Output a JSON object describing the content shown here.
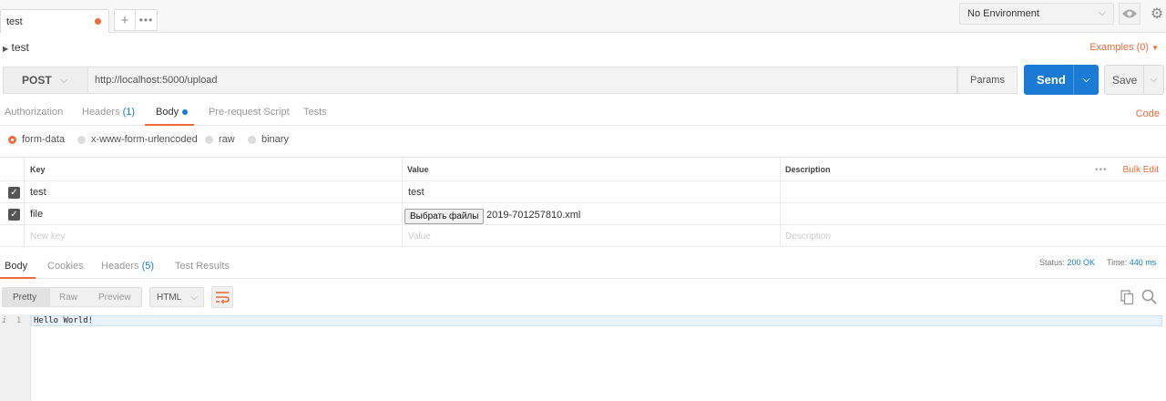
{
  "tabs": {
    "active_label": "test",
    "add_glyph": "+",
    "more_glyph": "•••"
  },
  "environment": {
    "selected": "No Environment"
  },
  "request": {
    "title": "test",
    "examples_label": "Examples (0)",
    "method": "POST",
    "url": "http://localhost:5000/upload",
    "params_label": "Params",
    "send_label": "Send",
    "save_label": "Save"
  },
  "request_tabs": {
    "authorization": "Authorization",
    "headers": "Headers",
    "headers_count": "(1)",
    "body": "Body",
    "prerequest": "Pre-request Script",
    "tests": "Tests",
    "code_link": "Code"
  },
  "body_types": {
    "form_data": "form-data",
    "urlencoded": "x-www-form-urlencoded",
    "raw": "raw",
    "binary": "binary",
    "selected": "form-data"
  },
  "form_table": {
    "headers": {
      "key": "Key",
      "value": "Value",
      "description": "Description",
      "bulk_edit": "Bulk Edit",
      "more": "•••"
    },
    "rows": [
      {
        "key": "test",
        "value": "test",
        "checked": true
      },
      {
        "key": "file",
        "file_button": "Выбрать файлы",
        "file_name": "2019-701257810.xml",
        "checked": true
      }
    ],
    "placeholders": {
      "key": "New key",
      "value": "Value",
      "description": "Description"
    }
  },
  "response_tabs": {
    "body": "Body",
    "cookies": "Cookies",
    "headers": "Headers",
    "headers_count": "(5)",
    "test_results": "Test Results"
  },
  "response_status": {
    "status_label": "Status:",
    "status_value": "200 OK",
    "time_label": "Time:",
    "time_value": "440 ms"
  },
  "response_view": {
    "pretty": "Pretty",
    "raw": "Raw",
    "preview": "Preview",
    "format": "HTML"
  },
  "response_body": {
    "line_number": "1",
    "line_marker": "i",
    "text": "Hello World!"
  },
  "colors": {
    "accent": "#f26b3a",
    "primary": "#1b7bd4"
  }
}
